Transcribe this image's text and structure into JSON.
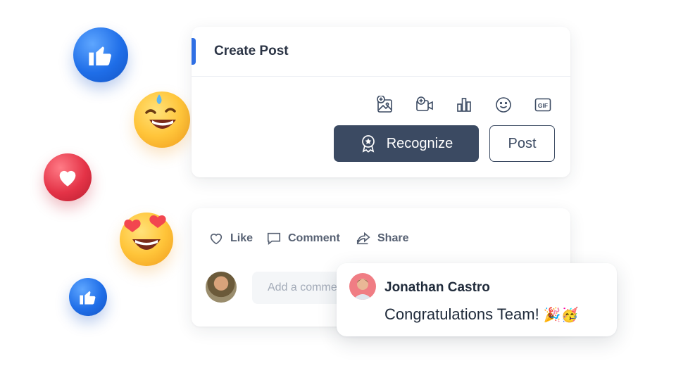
{
  "create_post": {
    "title": "Create Post",
    "tools": [
      "add-image-icon",
      "add-video-icon",
      "poll-icon",
      "emoji-icon",
      "gif-icon"
    ],
    "gif_label": "GIF",
    "recognize_label": "Recognize",
    "post_label": "Post"
  },
  "feed": {
    "like_label": "Like",
    "comment_label": "Comment",
    "share_label": "Share",
    "comment_placeholder": "Add a comment"
  },
  "popup": {
    "name": "Jonathan Castro",
    "message": "Congratulations Team!",
    "emoji": "🎉🥳"
  },
  "colors": {
    "accent": "#2f6fe4",
    "primary_button": "#3b4a62",
    "like_blue": "#1f6ee8",
    "heart_red": "#e43347"
  }
}
